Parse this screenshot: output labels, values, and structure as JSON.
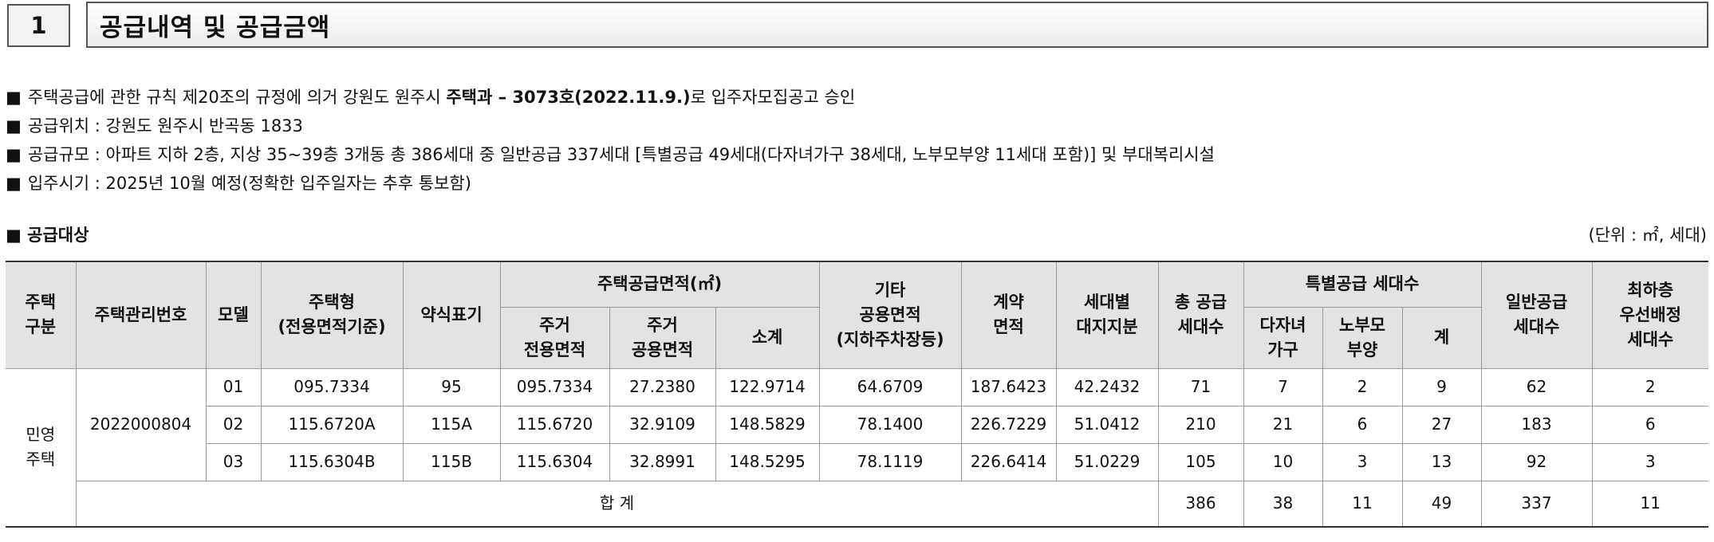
{
  "section": {
    "number": "1",
    "title": "공급내역 및 공급금액"
  },
  "bullets": [
    {
      "mark": "■",
      "pre": "주택공급에 관한 규칙 제20조의 규정에 의거 강원도 원주시 ",
      "bold": "주택과 – 3073호(2022.11.9.)",
      "post": "로 입주자모집공고 승인"
    },
    {
      "mark": "■",
      "pre": "공급위치 : 강원도 원주시 반곡동 1833",
      "bold": "",
      "post": ""
    },
    {
      "mark": "■",
      "pre": "공급규모 : 아파트 지하 2층, 지상 35~39층 3개동 총 386세대 중 일반공급 337세대 [특별공급 49세대(다자녀가구 38세대, 노부모부양 11세대 포함)] 및 부대복리시설",
      "bold": "",
      "post": ""
    },
    {
      "mark": "■",
      "pre": "입주시기 : 2025년 10월 예정(정확한 입주일자는 추후 통보함)",
      "bold": "",
      "post": ""
    }
  ],
  "table_section": {
    "heading": "■ 공급대상",
    "unit": "(단위 : ㎡, 세대)"
  },
  "headers": {
    "housing_type": [
      "주택",
      "구분"
    ],
    "mgmt_no": "주택관리번호",
    "model": "모델",
    "house_type": [
      "주택형",
      "(전용면적기준)"
    ],
    "short": "약식표기",
    "area_group": "주택공급면적(㎡)",
    "exclusive": [
      "주거",
      "전용면적"
    ],
    "common": [
      "주거",
      "공용면적"
    ],
    "subtotal": "소계",
    "other_common": [
      "기타",
      "공용면적",
      "(지하주차장등)"
    ],
    "contract": [
      "계약",
      "면적"
    ],
    "land": [
      "세대별",
      "대지지분"
    ],
    "total_units": [
      "총 공급",
      "세대수"
    ],
    "special_group": "특별공급 세대수",
    "multi_child": [
      "다자녀",
      "가구"
    ],
    "elderly": [
      "노부모",
      "부양"
    ],
    "special_sum": "계",
    "general": [
      "일반공급",
      "세대수"
    ],
    "lowest": [
      "최하층",
      "우선배정",
      "세대수"
    ]
  },
  "housing_type_value": [
    "민영",
    "주택"
  ],
  "mgmt_no_value": "2022000804",
  "rows": [
    {
      "model": "01",
      "house_type": "095.7334",
      "short": "95",
      "exclusive": "095.7334",
      "common": "27.2380",
      "subtotal": "122.9714",
      "other": "64.6709",
      "contract": "187.6423",
      "land": "42.2432",
      "total": "71",
      "multi": "7",
      "elderly": "2",
      "special": "9",
      "general": "62",
      "lowest": "2"
    },
    {
      "model": "02",
      "house_type": "115.6720A",
      "short": "115A",
      "exclusive": "115.6720",
      "common": "32.9109",
      "subtotal": "148.5829",
      "other": "78.1400",
      "contract": "226.7229",
      "land": "51.0412",
      "total": "210",
      "multi": "21",
      "elderly": "6",
      "special": "27",
      "general": "183",
      "lowest": "6"
    },
    {
      "model": "03",
      "house_type": "115.6304B",
      "short": "115B",
      "exclusive": "115.6304",
      "common": "32.8991",
      "subtotal": "148.5295",
      "other": "78.1119",
      "contract": "226.6414",
      "land": "51.0229",
      "total": "105",
      "multi": "10",
      "elderly": "3",
      "special": "13",
      "general": "92",
      "lowest": "3"
    }
  ],
  "totals": {
    "label": "합 계",
    "total": "386",
    "multi": "38",
    "elderly": "11",
    "special": "49",
    "general": "337",
    "lowest": "11"
  }
}
